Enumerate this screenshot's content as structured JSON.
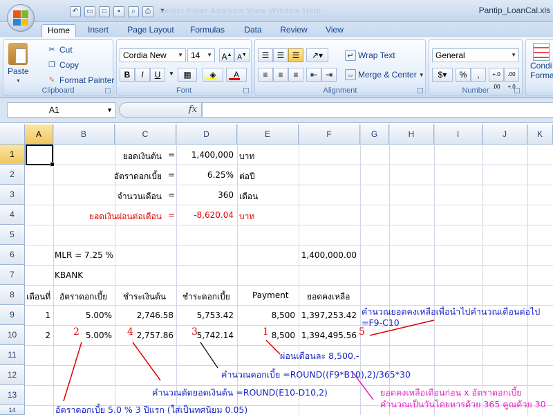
{
  "window": {
    "title": "Pantip_LoanCal.xls",
    "ghost_menu": "Select  Filter  Analysis   View   Window   Help"
  },
  "ribbon": {
    "tabs": [
      "Home",
      "Insert",
      "Page Layout",
      "Formulas",
      "Data",
      "Review",
      "View"
    ],
    "active_tab": "Home",
    "clipboard": {
      "paste": "Paste",
      "cut": "Cut",
      "copy": "Copy",
      "format_painter": "Format Painter",
      "label": "Clipboard"
    },
    "font": {
      "name": "Cordia New",
      "size": "14",
      "bold": "B",
      "italic": "I",
      "underline": "U",
      "label": "Font"
    },
    "alignment": {
      "wrap_text": "Wrap Text",
      "merge_center": "Merge & Center",
      "label": "Alignment"
    },
    "number": {
      "format": "General",
      "label": "Number",
      "percent": "%",
      "comma": ",",
      "inc_dec": "+.0 .00",
      "dec_dec": ".00 +.0"
    },
    "styles": {
      "conditional": "Condi",
      "format": "Forma"
    }
  },
  "formula_bar": {
    "name_box": "A1",
    "fx": "fx",
    "formula": ""
  },
  "columns": [
    "A",
    "B",
    "C",
    "D",
    "E",
    "F",
    "G",
    "H",
    "I",
    "J",
    "K"
  ],
  "rows": [
    "1",
    "2",
    "3",
    "4",
    "5",
    "6",
    "7",
    "8",
    "9",
    "10",
    "11",
    "12",
    "13",
    "14"
  ],
  "cells": {
    "c1": "ยอดเงินต้น",
    "e1c": "=",
    "d1": "1,400,000",
    "e1": "บาท",
    "c2": "อัตราดอกเบี้ย",
    "e2c": "=",
    "d2": "6.25%",
    "e2": "ต่อปี",
    "c3": "จำนวนเดือน",
    "e3c": "=",
    "d3": "360",
    "e3": "เดือน",
    "c4": "ยอดเงินผ่อนต่อเดือน",
    "e4c": "=",
    "d4": "-8,620.04",
    "e4": "บาท",
    "b6": "MLR = 7.25 %",
    "f6": "1,400,000.00",
    "b7": "KBANK",
    "a8": "เดือนที่",
    "b8": "อัตราดอกเบี้ย",
    "c8": "ชำระเงินต้น",
    "d8": "ชำระดอกเบี้ย",
    "e8": "Payment",
    "f8": "ยอดคงเหลือ",
    "a9": "1",
    "b9": "5.00%",
    "c9": "2,746.58",
    "d9": "5,753.42",
    "e9": "8,500",
    "f9": "1,397,253.42",
    "a10": "2",
    "b10": "5.00%",
    "c10": "2,757.86",
    "d10": "5,742.14",
    "e10": "8,500",
    "f10": "1,394,495.56"
  },
  "annotations": {
    "n1": "1",
    "n2": "2",
    "n3": "3",
    "n4": "4",
    "n5": "5",
    "g9_text": "คำนวณยอดคงเหลือเพื่อนำไปคำนวณเดือนต่อไป",
    "g9_formula": "=F9-C10",
    "pay_note": "ผ่อนเดือนละ 8,500.-",
    "interest_calc": "คำนวณดอกเบี้ย  =ROUND((F9*B10),2)/365*30",
    "principal_calc": "คำนวณตัดยอดเงินต้น    =ROUND(E10-D10,2)",
    "magenta_1": "ยอดคงเหลือเดือนก่อน x อัตราดอกเบี้ย",
    "magenta_2": "คำนวณเป็นวันโดยหารด้วย 365 คูณด้วย 30",
    "rate_note": "อัตราดอกเบี้ย 5.0 % 3 ปีแรก (ใส่เป็นทศนิยม 0.05)"
  },
  "colors": {
    "accent_red": "#e00000",
    "annotation_blue": "#1524c8",
    "annotation_magenta": "#e820c8"
  }
}
